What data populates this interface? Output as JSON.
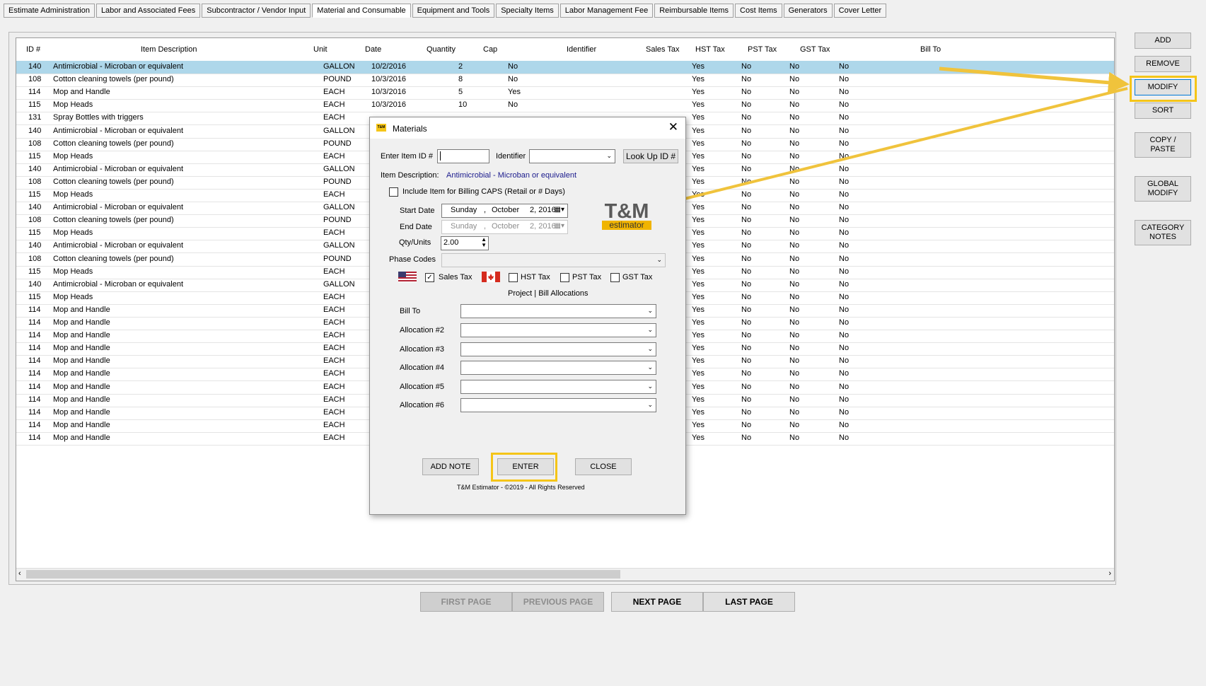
{
  "tabs": [
    "Estimate Administration",
    "Labor and Associated Fees",
    "Subcontractor / Vendor Input",
    "Material and Consumable",
    "Equipment and Tools",
    "Specialty Items",
    "Labor Management Fee",
    "Reimbursable Items",
    "Cost Items",
    "Generators",
    "Cover Letter"
  ],
  "active_tab": 3,
  "grid": {
    "headers": [
      "ID #",
      "Item Description",
      "Unit",
      "Date",
      "Quantity",
      "Cap",
      "Identifier",
      "Sales Tax",
      "HST Tax",
      "PST Tax",
      "GST Tax",
      "Bill To"
    ],
    "rows": [
      [
        "140",
        "Antimicrobial - Microban or equivalent",
        "GALLON",
        "10/2/2016",
        "2",
        "No",
        "",
        "Yes",
        "No",
        "No",
        "No"
      ],
      [
        "108",
        "Cotton cleaning towels (per pound)",
        "POUND",
        "10/3/2016",
        "8",
        "No",
        "",
        "Yes",
        "No",
        "No",
        "No"
      ],
      [
        "114",
        "Mop and Handle",
        "EACH",
        "10/3/2016",
        "5",
        "Yes",
        "",
        "Yes",
        "No",
        "No",
        "No"
      ],
      [
        "115",
        "Mop Heads",
        "EACH",
        "10/3/2016",
        "10",
        "No",
        "",
        "Yes",
        "No",
        "No",
        "No"
      ],
      [
        "131",
        "Spray Bottles with triggers",
        "EACH",
        "",
        "",
        "",
        "",
        "Yes",
        "No",
        "No",
        "No"
      ],
      [
        "140",
        "Antimicrobial - Microban or equivalent",
        "GALLON",
        "",
        "",
        "",
        "",
        "Yes",
        "No",
        "No",
        "No"
      ],
      [
        "108",
        "Cotton cleaning towels (per pound)",
        "POUND",
        "",
        "",
        "",
        "",
        "Yes",
        "No",
        "No",
        "No"
      ],
      [
        "115",
        "Mop Heads",
        "EACH",
        "",
        "",
        "",
        "",
        "Yes",
        "No",
        "No",
        "No"
      ],
      [
        "140",
        "Antimicrobial - Microban or equivalent",
        "GALLON",
        "",
        "",
        "",
        "",
        "Yes",
        "No",
        "No",
        "No"
      ],
      [
        "108",
        "Cotton cleaning towels (per pound)",
        "POUND",
        "",
        "",
        "",
        "",
        "Yes",
        "No",
        "No",
        "No"
      ],
      [
        "115",
        "Mop Heads",
        "EACH",
        "",
        "",
        "",
        "",
        "Yes",
        "No",
        "No",
        "No"
      ],
      [
        "140",
        "Antimicrobial - Microban or equivalent",
        "GALLON",
        "",
        "",
        "",
        "",
        "Yes",
        "No",
        "No",
        "No"
      ],
      [
        "108",
        "Cotton cleaning towels (per pound)",
        "POUND",
        "",
        "",
        "",
        "",
        "Yes",
        "No",
        "No",
        "No"
      ],
      [
        "115",
        "Mop Heads",
        "EACH",
        "",
        "",
        "",
        "",
        "Yes",
        "No",
        "No",
        "No"
      ],
      [
        "140",
        "Antimicrobial - Microban or equivalent",
        "GALLON",
        "",
        "",
        "",
        "",
        "Yes",
        "No",
        "No",
        "No"
      ],
      [
        "108",
        "Cotton cleaning towels (per pound)",
        "POUND",
        "",
        "",
        "",
        "",
        "Yes",
        "No",
        "No",
        "No"
      ],
      [
        "115",
        "Mop Heads",
        "EACH",
        "",
        "",
        "",
        "",
        "Yes",
        "No",
        "No",
        "No"
      ],
      [
        "140",
        "Antimicrobial - Microban or equivalent",
        "GALLON",
        "",
        "",
        "",
        "",
        "Yes",
        "No",
        "No",
        "No"
      ],
      [
        "115",
        "Mop Heads",
        "EACH",
        "",
        "",
        "",
        "",
        "Yes",
        "No",
        "No",
        "No"
      ],
      [
        "114",
        "Mop and Handle",
        "EACH",
        "",
        "",
        "",
        "",
        "Yes",
        "No",
        "No",
        "No"
      ],
      [
        "114",
        "Mop and Handle",
        "EACH",
        "",
        "",
        "",
        "",
        "Yes",
        "No",
        "No",
        "No"
      ],
      [
        "114",
        "Mop and Handle",
        "EACH",
        "",
        "",
        "",
        "",
        "Yes",
        "No",
        "No",
        "No"
      ],
      [
        "114",
        "Mop and Handle",
        "EACH",
        "",
        "",
        "",
        "",
        "Yes",
        "No",
        "No",
        "No"
      ],
      [
        "114",
        "Mop and Handle",
        "EACH",
        "",
        "",
        "",
        "",
        "Yes",
        "No",
        "No",
        "No"
      ],
      [
        "114",
        "Mop and Handle",
        "EACH",
        "",
        "",
        "",
        "",
        "Yes",
        "No",
        "No",
        "No"
      ],
      [
        "114",
        "Mop and Handle",
        "EACH",
        "",
        "",
        "",
        "",
        "Yes",
        "No",
        "No",
        "No"
      ],
      [
        "114",
        "Mop and Handle",
        "EACH",
        "",
        "",
        "",
        "",
        "Yes",
        "No",
        "No",
        "No"
      ],
      [
        "114",
        "Mop and Handle",
        "EACH",
        "",
        "",
        "",
        "",
        "Yes",
        "No",
        "No",
        "No"
      ],
      [
        "114",
        "Mop and Handle",
        "EACH",
        "",
        "",
        "",
        "",
        "Yes",
        "No",
        "No",
        "No"
      ],
      [
        "114",
        "Mop and Handle",
        "EACH",
        "",
        "",
        "",
        "",
        "Yes",
        "No",
        "No",
        "No"
      ]
    ]
  },
  "side_buttons": [
    "ADD",
    "REMOVE",
    "MODIFY",
    "SORT",
    "COPY /\nPASTE",
    "GLOBAL\nMODIFY",
    "CATEGORY\nNOTES"
  ],
  "paging": {
    "first": "FIRST PAGE",
    "previous": "PREVIOUS PAGE",
    "next": "NEXT PAGE",
    "last": "LAST PAGE"
  },
  "dialog": {
    "title": "Materials",
    "app_icon": "T&M",
    "enter_item_label": "Enter Item ID #",
    "identifier_label": "Identifier",
    "lookup_label": "Look Up ID #",
    "item_desc_label": "Item Description:",
    "item_desc_value": "Antimicrobial - Microban or equivalent",
    "include_caps_label": "Include Item for Billing CAPS (Retail or # Days)",
    "start_date_label": "Start Date",
    "start_date": {
      "weekday": "Sunday",
      "month": "October",
      "day": "2, 2016"
    },
    "end_date_label": "End Date",
    "end_date": {
      "weekday": "Sunday",
      "month": "October",
      "day": "2, 2016"
    },
    "qty_label": "Qty/Units",
    "qty_value": "2.00",
    "phase_label": "Phase Codes",
    "sales_tax_label": "Sales Tax",
    "sales_tax_checked": true,
    "hst_label": "HST Tax",
    "pst_label": "PST Tax",
    "gst_label": "GST Tax",
    "allocations_header": "Project | Bill Allocations",
    "bill_to_label": "Bill To",
    "alloc_labels": [
      "Allocation #2",
      "Allocation #3",
      "Allocation #4",
      "Allocation #5",
      "Allocation #6"
    ],
    "add_note_label": "ADD NOTE",
    "enter_label": "ENTER",
    "close_label": "CLOSE",
    "footer": "T&M Estimator - ©2019 - All Rights Reserved",
    "logo_top": "T&M",
    "logo_bottom": "estimator"
  },
  "colors": {
    "highlight": "#f5c518",
    "selected_row": "#aed7ea",
    "desc_link": "#1a1a8c"
  }
}
